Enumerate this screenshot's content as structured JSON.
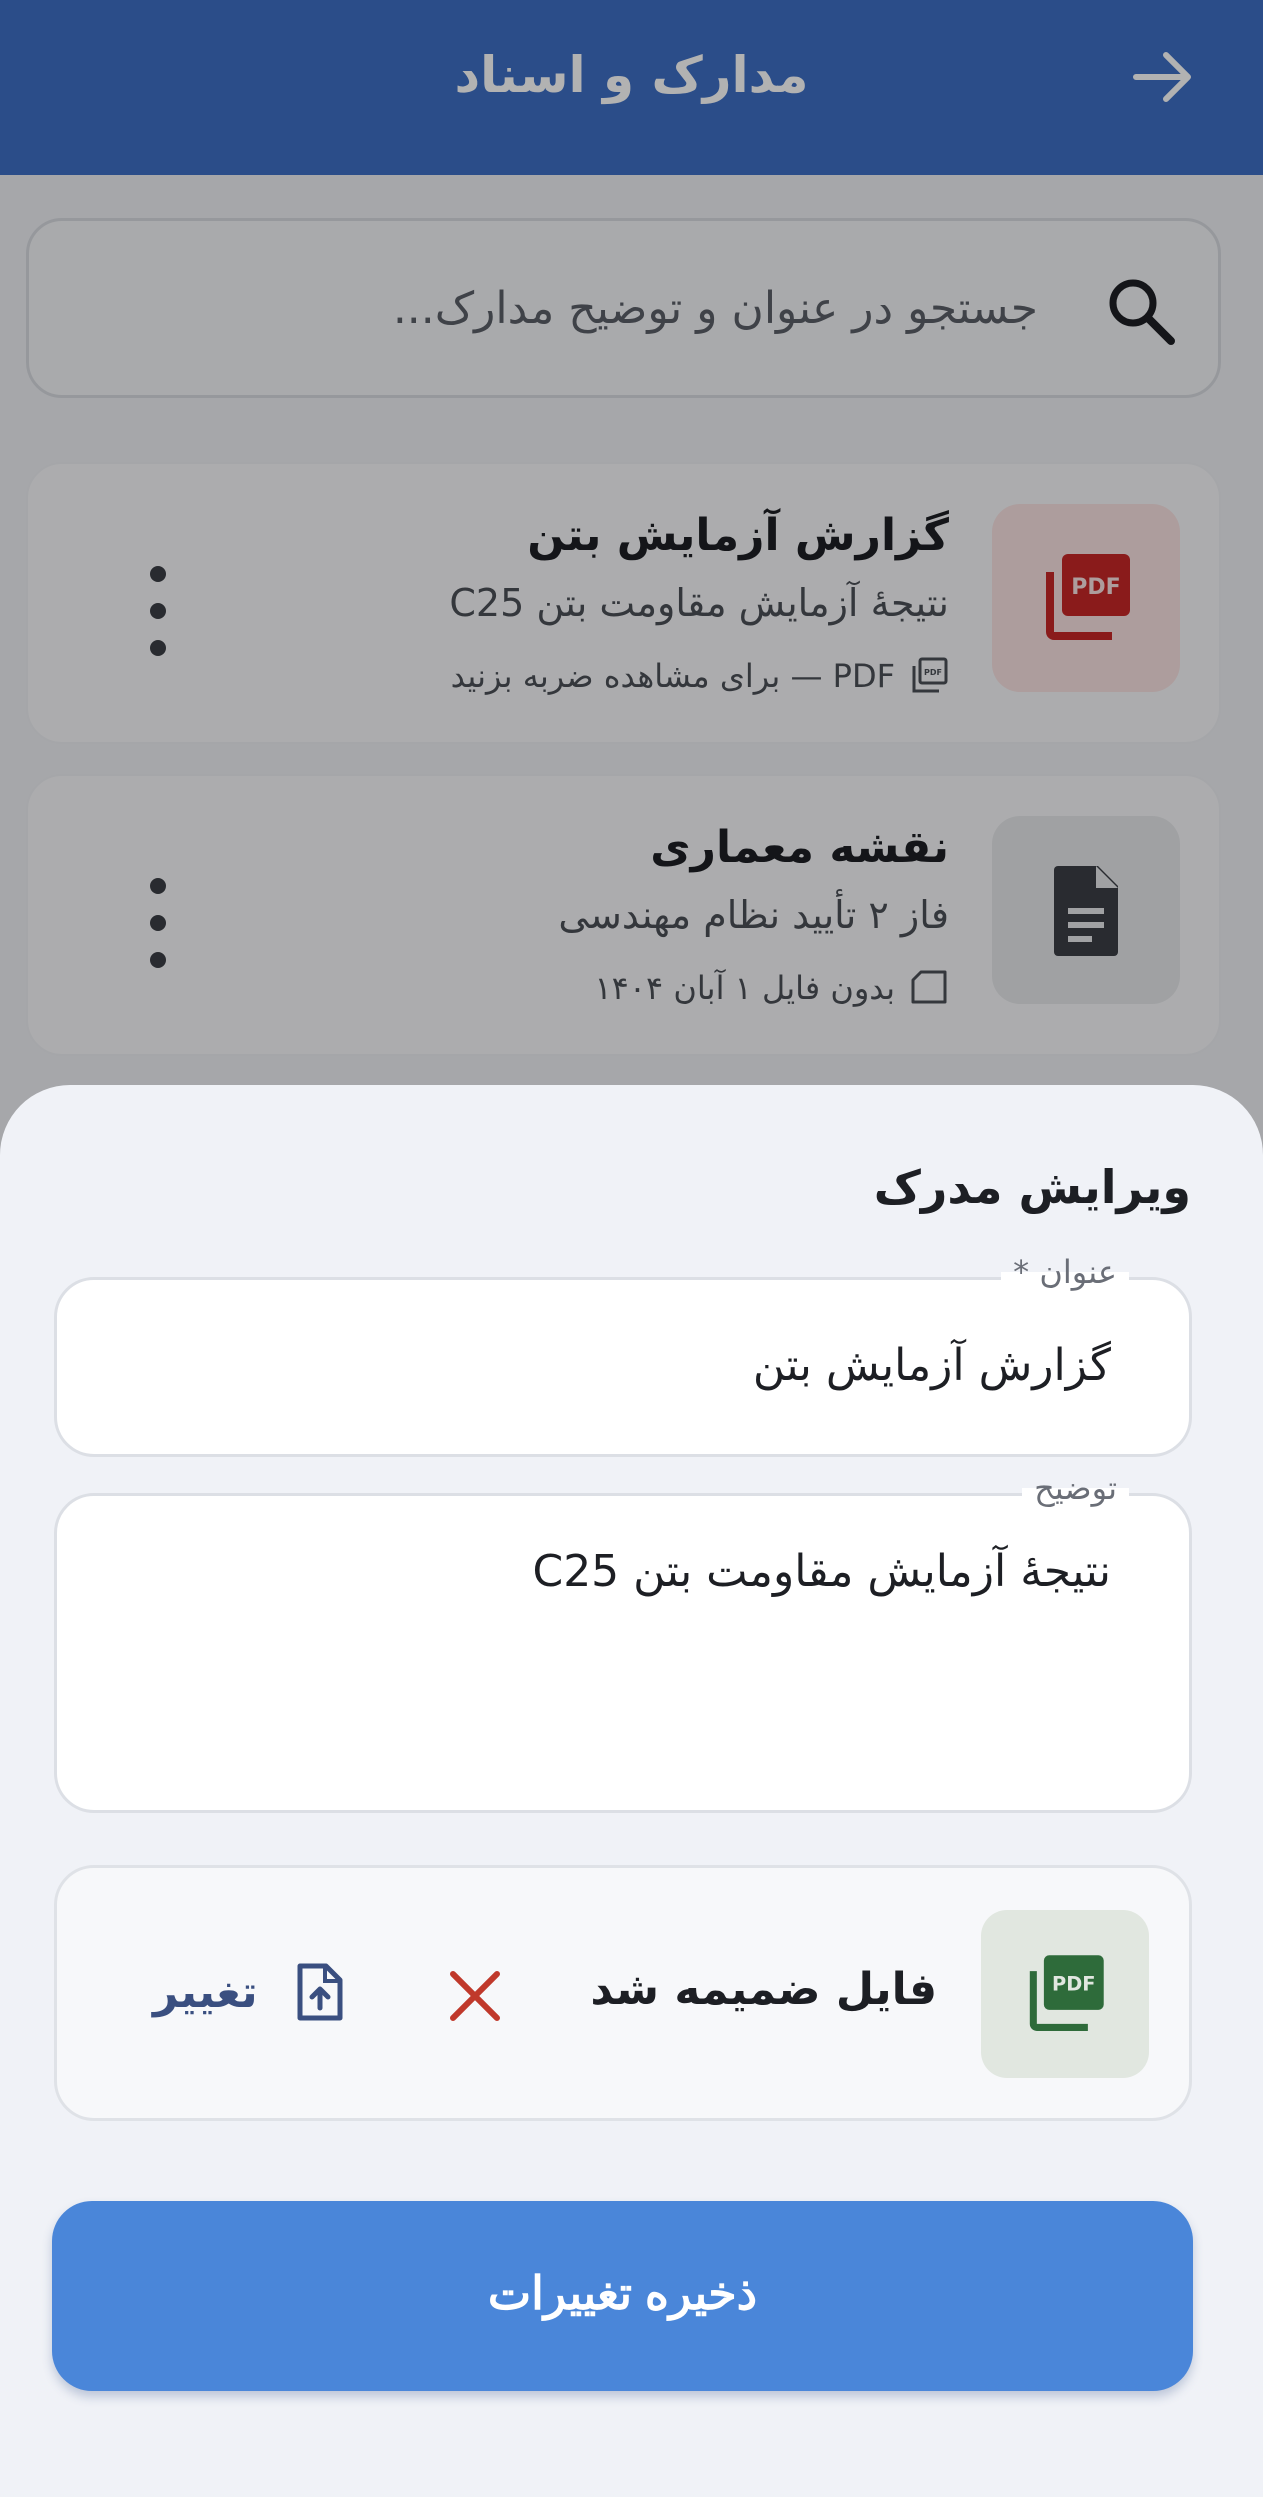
{
  "app_bar": {
    "title": "مدارک و اسناد",
    "back_icon": "arrow-back-icon"
  },
  "search": {
    "placeholder": "جستجو در عنوان و توضیح مدارک...",
    "icon": "search-icon"
  },
  "documents": [
    {
      "title": "گزارش آزمایش بتن",
      "description": "نتیجهٔ آزمایش مقاومت بتن C25",
      "meta": "PDF — برای مشاهده ضربه بزنید",
      "meta_icon": "pdf-small-icon",
      "thumb_icon": "pdf-icon",
      "thumb_color": "#c62828"
    },
    {
      "title": "نقشه معماری",
      "description": "فاز ۲ تأیید نظام مهندسی",
      "meta": "بدون فایل   ۱ آبان ۱۴۰۴",
      "meta_icon": "folder-outline-icon",
      "thumb_icon": "document-icon",
      "thumb_color": "#5f6368"
    }
  ],
  "sheet": {
    "title": "ویرایش مدرک",
    "title_field": {
      "label": "عنوان *",
      "value": "گزارش آزمایش بتن"
    },
    "description_field": {
      "label": "توضیح",
      "value": "نتیجهٔ آزمایش مقاومت بتن C25"
    },
    "attachment": {
      "label": "فایل ضمیمه شد",
      "change_label": "تغییر",
      "thumb_icon": "pdf-icon",
      "thumb_color": "#2e6b3a",
      "remove_icon": "close-icon",
      "remove_color": "#c0392b"
    },
    "save_label": "ذخیره تغییرات"
  },
  "colors": {
    "primary": "#3e6fc4",
    "save_button": "#4a86d9"
  }
}
